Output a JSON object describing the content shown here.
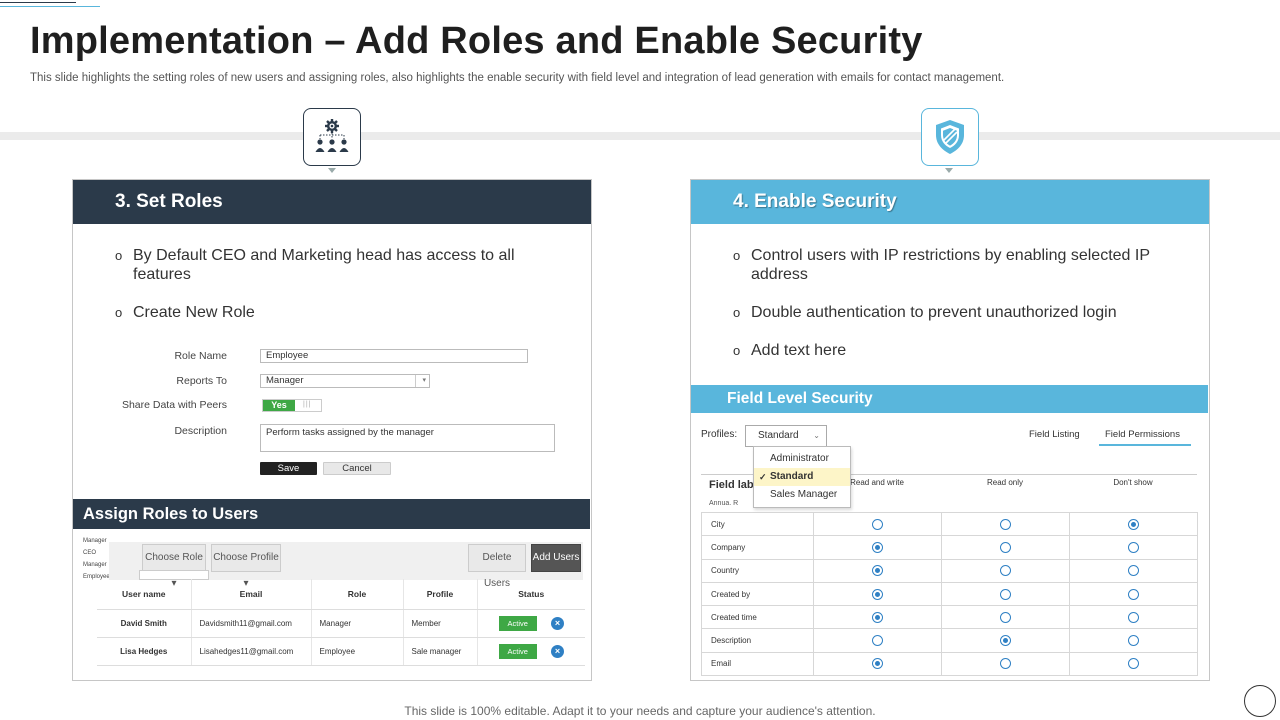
{
  "slide": {
    "title": "Implementation – Add Roles and Enable Security",
    "subtitle": "This slide highlights the setting roles of new users and assigning roles, also highlights the enable security with field level and integration of lead generation with emails for contact management.",
    "footer": "This slide is 100% editable. Adapt it to your needs and capture your audience's attention."
  },
  "colors": {
    "dark": "#2b3a4a",
    "accent": "#59b6dc",
    "green": "#3ea845",
    "blue": "#2f80c4"
  },
  "icons": {
    "roles": "team-gear-icon",
    "security": "shield-icon"
  },
  "set_roles": {
    "heading": "3. Set Roles",
    "bullet_mark": "o",
    "bullets": [
      "By Default CEO and Marketing head has access to all features",
      "Create New Role"
    ],
    "form": {
      "role_name_label": "Role Name",
      "role_name_value": "Employee",
      "reports_to_label": "Reports To",
      "reports_to_value": "Manager",
      "share_label": "Share Data with Peers",
      "share_value": "Yes",
      "description_label": "Description",
      "description_value": "Perform tasks assigned by the manager",
      "save": "Save",
      "cancel": "Cancel"
    },
    "assign": {
      "heading": "Assign Roles to Users",
      "mini_list": [
        "Manager",
        "CEO",
        "Manager",
        "Employee"
      ],
      "choose_role": "Choose Role",
      "choose_profile": "Choose Profile",
      "delete_users": "Delete Users",
      "add_users": "Add Users",
      "columns": [
        "User name",
        "Email",
        "Role",
        "Profile",
        "Status"
      ],
      "rows": [
        {
          "name": "David Smith",
          "email": "Davidsmith11@gmail.com",
          "role": "Manager",
          "profile": "Member",
          "status": "Active"
        },
        {
          "name": "Lisa Hedges",
          "email": "Lisahedges11@gmail.com",
          "role": "Employee",
          "profile": "Sale manager",
          "status": "Active"
        }
      ]
    }
  },
  "enable_security": {
    "heading": "4. Enable Security",
    "bullet_mark": "o",
    "bullets": [
      "Control users with IP restrictions by enabling selected IP address",
      "Double authentication to prevent unauthorized login",
      "Add text here"
    ],
    "fls": {
      "heading": "Field Level Security",
      "profiles_label": "Profiles:",
      "profile_value": "Standard",
      "tab_listing": "Field Listing",
      "tab_permissions": "Field Permissions",
      "dropdown_options": [
        "Administrator",
        "Standard",
        "Sales Manager"
      ],
      "dropdown_selected": 1,
      "field_label_header": "Field lab",
      "annual_text": "Annua. R",
      "columns": [
        "Read and write",
        "Read only",
        "Don't show"
      ],
      "rows": [
        {
          "field": "City",
          "selected": 2
        },
        {
          "field": "Company",
          "selected": 0
        },
        {
          "field": "Country",
          "selected": 0
        },
        {
          "field": "Created by",
          "selected": 0
        },
        {
          "field": "Created time",
          "selected": 0
        },
        {
          "field": "Description",
          "selected": 1
        },
        {
          "field": "Email",
          "selected": 0
        }
      ]
    }
  }
}
